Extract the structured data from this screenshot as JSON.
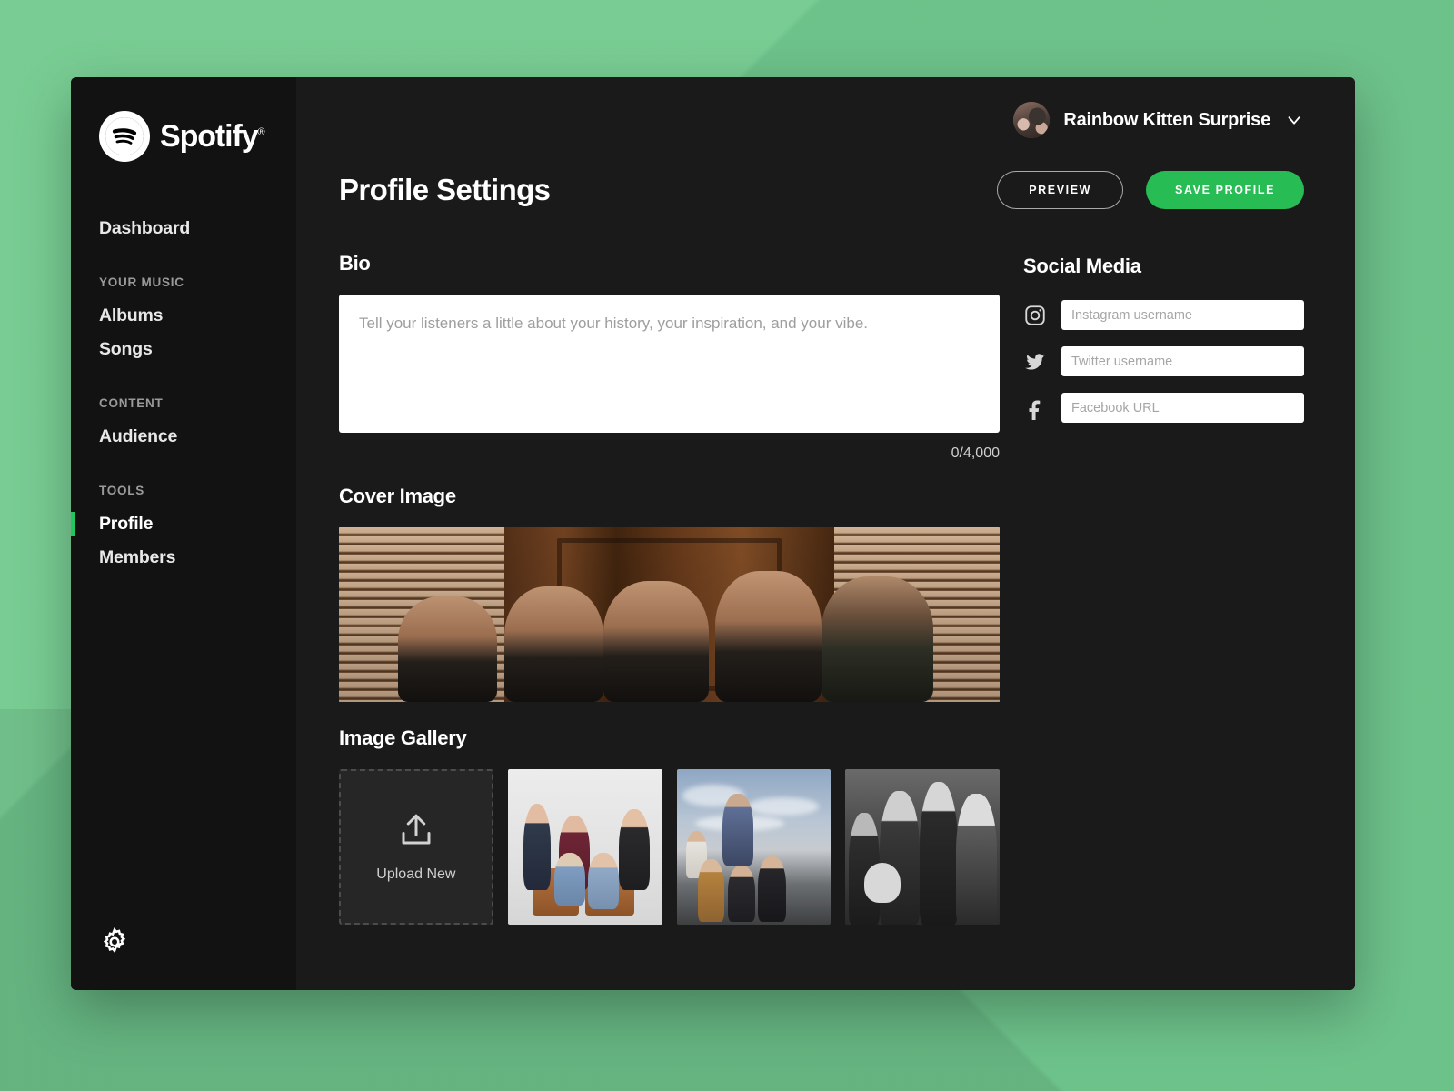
{
  "brand": {
    "name": "Spotify",
    "trademark": "®"
  },
  "sidebar": {
    "nav": [
      {
        "label": "Dashboard",
        "active": false
      },
      {
        "label": "YOUR MUSIC",
        "group": true
      },
      {
        "label": "Albums",
        "active": false
      },
      {
        "label": "Songs",
        "active": false
      },
      {
        "label": "CONTENT",
        "group": true
      },
      {
        "label": "Audience",
        "active": false
      },
      {
        "label": "TOOLS",
        "group": true
      },
      {
        "label": "Profile",
        "active": true
      },
      {
        "label": "Members",
        "active": false
      }
    ],
    "settings_icon": "gear-icon"
  },
  "topbar": {
    "account_name": "Rainbow Kitten Surprise",
    "avatar": "artist-avatar",
    "dropdown_icon": "chevron-down-icon"
  },
  "header": {
    "title": "Profile Settings",
    "preview_label": "PREVIEW",
    "save_label": "SAVE PROFILE"
  },
  "bio": {
    "title": "Bio",
    "value": "",
    "placeholder": "Tell your listeners a little about your history, your inspiration, and your vibe.",
    "counter": "0/4,000"
  },
  "cover": {
    "title": "Cover Image",
    "alt": "band-photo-wooden-door"
  },
  "gallery": {
    "title": "Image Gallery",
    "upload_label": "Upload New",
    "upload_icon": "upload-icon",
    "items": [
      {
        "alt": "band-studio-couch-photo"
      },
      {
        "alt": "band-outdoor-dusk-photo"
      },
      {
        "alt": "band-black-and-white-photo"
      }
    ]
  },
  "social": {
    "title": "Social Media",
    "fields": [
      {
        "icon": "instagram-icon",
        "placeholder": "Instagram username",
        "value": ""
      },
      {
        "icon": "twitter-icon",
        "placeholder": "Twitter username",
        "value": ""
      },
      {
        "icon": "facebook-icon",
        "placeholder": "Facebook URL",
        "value": ""
      }
    ]
  },
  "colors": {
    "accent_green": "#27bd54",
    "backdrop_green": "#72c990",
    "sidebar_bg": "#121212",
    "panel_bg": "#1a1a1a"
  }
}
